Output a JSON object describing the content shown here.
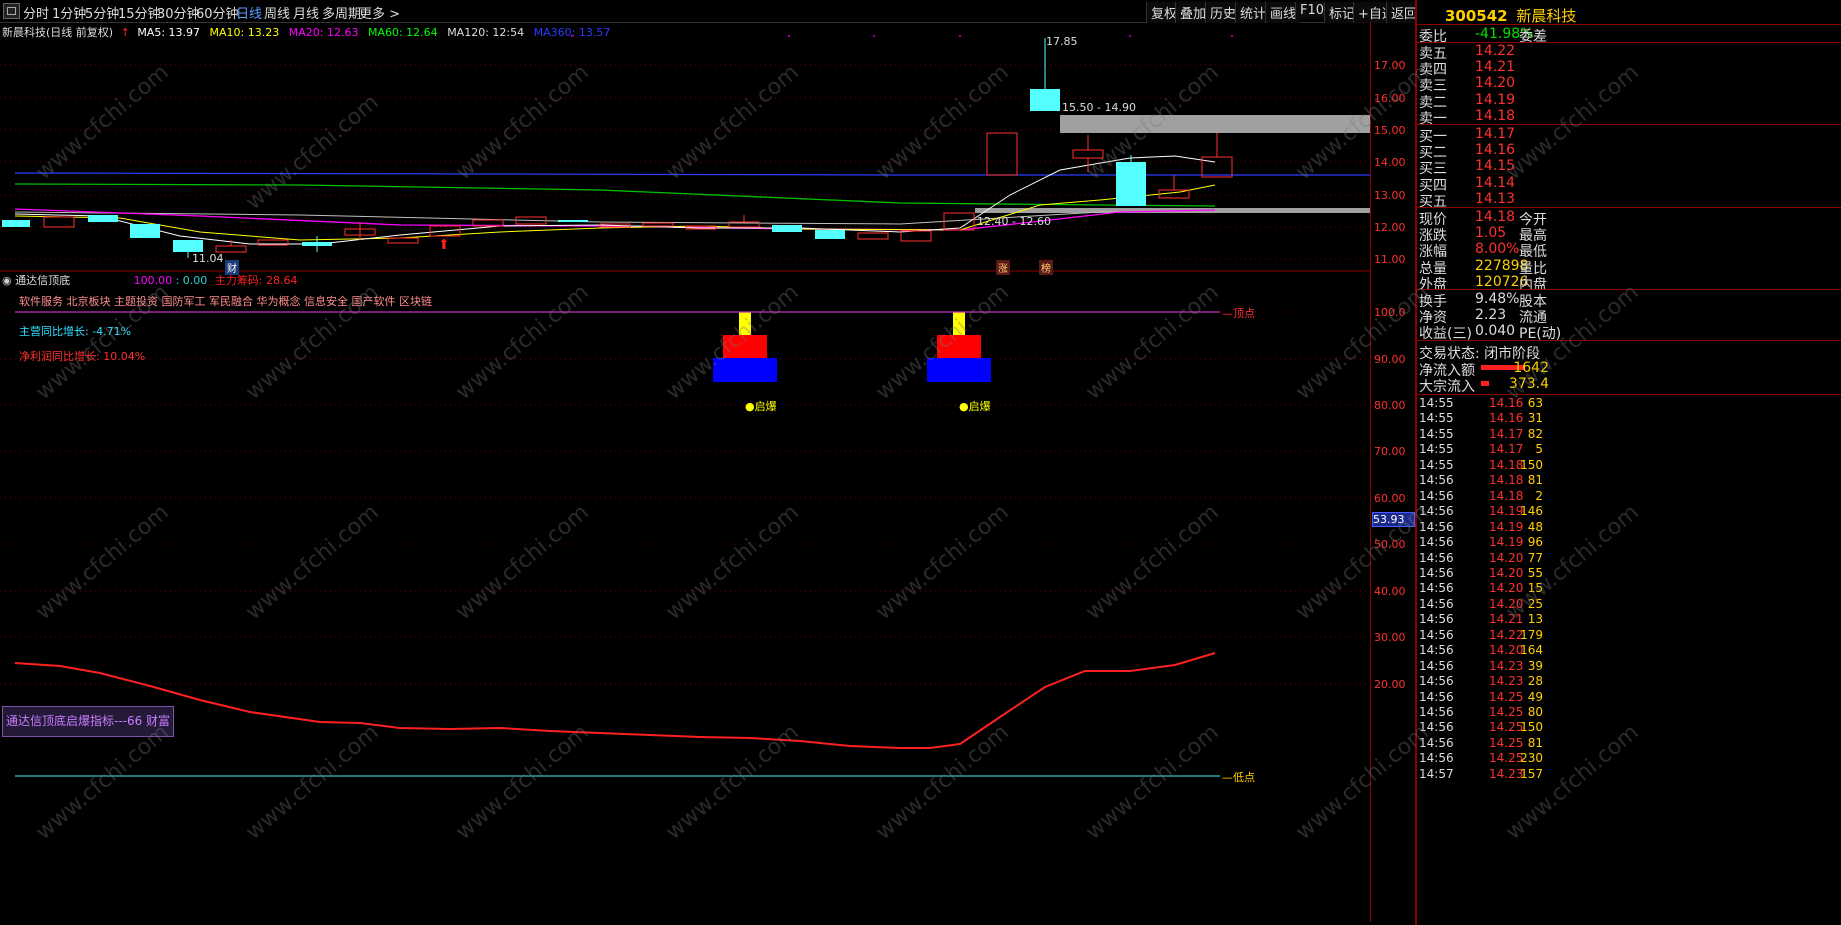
{
  "toolbar": {
    "periods": [
      "分时",
      "1分钟",
      "5分钟",
      "15分钟",
      "30分钟",
      "60分钟",
      "日线",
      "周线",
      "月线",
      "多周期",
      "更多 >"
    ],
    "active_period": "日线",
    "right_buttons": [
      "复权",
      "叠加",
      "历史",
      "统计",
      "画线",
      "F10",
      "标记",
      "+自选",
      "返回"
    ]
  },
  "ma_line": {
    "title": "新晨科技(日线 前复权)",
    "ma5": "MA5: 13.97",
    "ma10": "MA10: 13.23",
    "ma20": "MA20: 12.63",
    "ma60": "MA60: 12.64",
    "ma120": "MA120: 12:54",
    "ma360": "MA360: 13.57"
  },
  "price_axis": [
    "17.00",
    "16.00",
    "15.00",
    "14.00",
    "13.00",
    "12.00",
    "11.00"
  ],
  "price_annotations": {
    "high": "17.85",
    "low": "11.04",
    "zone_top": "15.50 - 14.90",
    "zone_bottom": "12.40 - 12.60",
    "cai_tag": "财",
    "zhang_tag": "涨",
    "bang_tag": "榜"
  },
  "indicator": {
    "name": "通达信顶底",
    "val1": "100.00",
    "val2": ": 0.00",
    "main_label": "主力筹码: 28.64",
    "concepts": "软件服务 北京板块 主题投资 国防军工 军民融合 华为概念 信息安全 国产软件 区块链",
    "revenue_growth": "主营同比增长: -4.71%",
    "profit_growth": "净利润同比增长: 10.04%",
    "top_label": "—顶点",
    "bottom_label": "—低点",
    "signal1": "●启爆",
    "signal2": "●启爆",
    "current_tag": "53.93",
    "legend": "通达信顶底启爆指标---66 财富"
  },
  "indicator_axis": [
    "100.0",
    "90.00",
    "80.00",
    "70.00",
    "60.00",
    "50.00",
    "40.00",
    "30.00",
    "20.00"
  ],
  "panel": {
    "code": "300542",
    "name": "新晨科技",
    "weibi_label": "委比",
    "weibi_value": "-41.98%",
    "weicha_label": "委差",
    "asks": [
      {
        "label": "卖五",
        "price": "14.22"
      },
      {
        "label": "卖四",
        "price": "14.21"
      },
      {
        "label": "卖三",
        "price": "14.20"
      },
      {
        "label": "卖二",
        "price": "14.19"
      },
      {
        "label": "卖一",
        "price": "14.18"
      }
    ],
    "bids": [
      {
        "label": "买一",
        "price": "14.17"
      },
      {
        "label": "买二",
        "price": "14.16"
      },
      {
        "label": "买三",
        "price": "14.15"
      },
      {
        "label": "买四",
        "price": "14.14"
      },
      {
        "label": "买五",
        "price": "14.13"
      }
    ],
    "stats": [
      {
        "label": "现价",
        "value": "14.18",
        "r": "今开"
      },
      {
        "label": "涨跌",
        "value": "1.05",
        "r": "最高"
      },
      {
        "label": "涨幅",
        "value": "8.00%",
        "r": "最低"
      },
      {
        "label": "总量",
        "value": "227898",
        "r": "量比"
      },
      {
        "label": "外盘",
        "value": "120726",
        "r": "内盘"
      }
    ],
    "stats2": [
      {
        "label": "换手",
        "value": "9.48%",
        "r": "股本"
      },
      {
        "label": "净资",
        "value": "2.23",
        "r": "流通"
      },
      {
        "label": "收益(三)",
        "value": "0.040",
        "r": "PE(动)"
      }
    ],
    "trade_state": "交易状态: 闭市阶段",
    "net_inflow_label": "净流入额",
    "net_inflow_value": "1642",
    "block_inflow_label": "大宗流入",
    "block_inflow_value": "373.4",
    "ticks": [
      {
        "t": "14:55",
        "p": "14.16",
        "v": "63"
      },
      {
        "t": "14:55",
        "p": "14.16",
        "v": "31"
      },
      {
        "t": "14:55",
        "p": "14.17",
        "v": "82"
      },
      {
        "t": "14:55",
        "p": "14.17",
        "v": "5"
      },
      {
        "t": "14:55",
        "p": "14.18",
        "v": "150"
      },
      {
        "t": "14:56",
        "p": "14.18",
        "v": "81"
      },
      {
        "t": "14:56",
        "p": "14.18",
        "v": "2"
      },
      {
        "t": "14:56",
        "p": "14.19",
        "v": "146"
      },
      {
        "t": "14:56",
        "p": "14.19",
        "v": "48"
      },
      {
        "t": "14:56",
        "p": "14.19",
        "v": "96"
      },
      {
        "t": "14:56",
        "p": "14.20",
        "v": "77"
      },
      {
        "t": "14:56",
        "p": "14.20",
        "v": "55"
      },
      {
        "t": "14:56",
        "p": "14.20",
        "v": "15"
      },
      {
        "t": "14:56",
        "p": "14.20",
        "v": "25"
      },
      {
        "t": "14:56",
        "p": "14.21",
        "v": "13"
      },
      {
        "t": "14:56",
        "p": "14.22",
        "v": "179"
      },
      {
        "t": "14:56",
        "p": "14.20",
        "v": "164"
      },
      {
        "t": "14:56",
        "p": "14.23",
        "v": "39"
      },
      {
        "t": "14:56",
        "p": "14.23",
        "v": "28"
      },
      {
        "t": "14:56",
        "p": "14.25",
        "v": "49"
      },
      {
        "t": "14:56",
        "p": "14.25",
        "v": "80"
      },
      {
        "t": "14:56",
        "p": "14.25",
        "v": "150"
      },
      {
        "t": "14:56",
        "p": "14.25",
        "v": "81"
      },
      {
        "t": "14:56",
        "p": "14.25",
        "v": "230"
      },
      {
        "t": "14:57",
        "p": "14.23",
        "v": "157"
      }
    ]
  },
  "watermark": "www.cfchi.com"
}
